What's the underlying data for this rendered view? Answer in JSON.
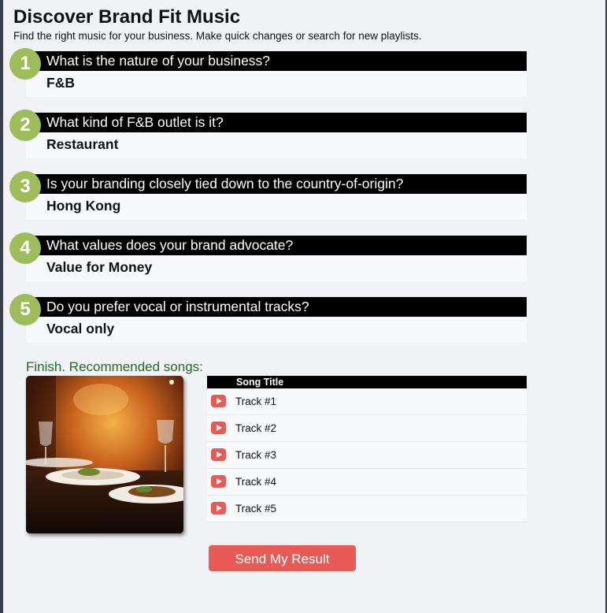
{
  "header": {
    "title": "Discover Brand Fit Music",
    "subtitle": "Find the right music for your business. Make quick changes or search for new playlists."
  },
  "questions": [
    {
      "number": "1",
      "question": "What is the nature of your business?",
      "answer": "F&B"
    },
    {
      "number": "2",
      "question": "What kind of F&B outlet is it?",
      "answer": "Restaurant"
    },
    {
      "number": "3",
      "question": "Is your branding closely tied down to the country-of-origin?",
      "answer": "Hong Kong"
    },
    {
      "number": "4",
      "question": "What values does your brand advocate?",
      "answer": "Value for Money"
    },
    {
      "number": "5",
      "question": "Do you prefer vocal or instrumental tracks?",
      "answer": "Vocal only"
    }
  ],
  "result": {
    "heading": "Finish. Recommended songs:",
    "image": "restaurant-dining-photo",
    "table_header": "Song Title",
    "tracks": [
      "Track #1",
      "Track #2",
      "Track #3",
      "Track #4",
      "Track #5"
    ],
    "play_icon": "play-icon"
  },
  "actions": {
    "send_label": "Send My Result"
  },
  "colors": {
    "step_badge": "#9ebd5a",
    "accent_red": "#e85a55",
    "finish_text": "#256a25",
    "header_bar": "#000000",
    "page_bg": "#f0f2f5"
  }
}
